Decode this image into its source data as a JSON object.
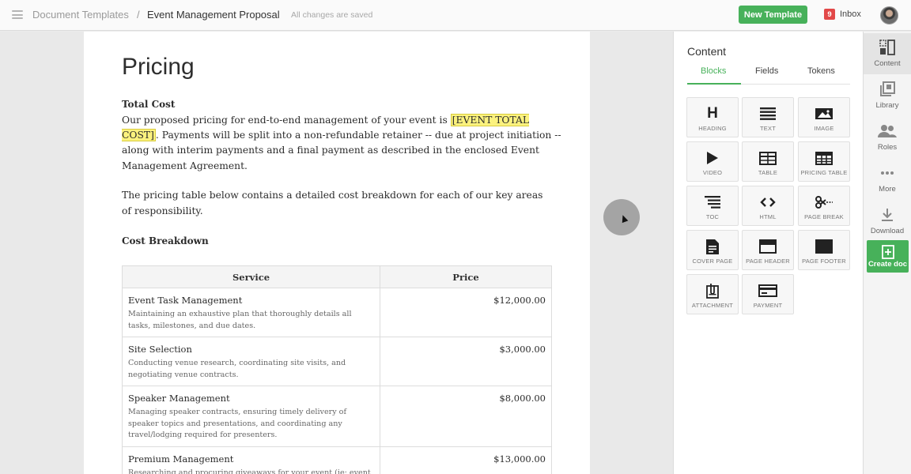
{
  "topbar": {
    "breadcrumb_root": "Document Templates",
    "separator": "/",
    "document_name": "Event Management Proposal",
    "save_status": "All changes are saved",
    "new_template_label": "New Template",
    "inbox_count": "9",
    "inbox_label": "Inbox"
  },
  "document": {
    "heading": "Pricing",
    "total_cost_heading": "Total Cost",
    "para1_before": "Our proposed pricing for end-to-end management of your event is ",
    "para1_token": "[EVENT TOTAL COST]",
    "para1_after": ". Payments will be split into a non-refundable retainer -- due at project initiation -- along with interim payments and a final payment as described in the enclosed Event Management Agreement.",
    "para2": "The pricing table below contains a detailed cost breakdown for each of our key areas of responsibility.",
    "cost_breakdown_heading": "Cost Breakdown",
    "table": {
      "headers": [
        "Service",
        "Price"
      ],
      "rows": [
        {
          "service": "Event Task Management",
          "description": "Maintaining an exhaustive plan that thoroughly details all tasks, milestones, and due dates.",
          "price": "$12,000.00"
        },
        {
          "service": "Site Selection",
          "description": "Conducting venue research, coordinating site visits, and negotiating venue contracts.",
          "price": "$3,000.00"
        },
        {
          "service": "Speaker Management",
          "description": "Managing speaker contracts, ensuring timely delivery of speaker topics and presentations, and coordinating any travel/lodging required for presenters.",
          "price": "$8,000.00"
        },
        {
          "service": "Premium Management",
          "description": "Researching and procuring giveaways for your event (ie: event swag,",
          "price": "$13,000.00"
        }
      ]
    }
  },
  "panel": {
    "title": "Content",
    "tabs": [
      "Blocks",
      "Fields",
      "Tokens"
    ],
    "active_tab": "Blocks",
    "blocks": [
      {
        "label": "HEADING",
        "icon": "heading-icon"
      },
      {
        "label": "TEXT",
        "icon": "text-icon"
      },
      {
        "label": "IMAGE",
        "icon": "image-icon"
      },
      {
        "label": "VIDEO",
        "icon": "video-icon"
      },
      {
        "label": "TABLE",
        "icon": "table-icon"
      },
      {
        "label": "PRICING TABLE",
        "icon": "pricing-table-icon"
      },
      {
        "label": "TOC",
        "icon": "toc-icon"
      },
      {
        "label": "HTML",
        "icon": "html-icon"
      },
      {
        "label": "PAGE BREAK",
        "icon": "page-break-icon"
      },
      {
        "label": "COVER PAGE",
        "icon": "cover-page-icon"
      },
      {
        "label": "PAGE HEADER",
        "icon": "page-header-icon"
      },
      {
        "label": "PAGE FOOTER",
        "icon": "page-footer-icon"
      },
      {
        "label": "ATTACHMENT",
        "icon": "attachment-icon"
      },
      {
        "label": "PAYMENT",
        "icon": "payment-icon"
      }
    ]
  },
  "rail": {
    "items": [
      {
        "label": "Content",
        "icon": "content-icon"
      },
      {
        "label": "Library",
        "icon": "library-icon"
      },
      {
        "label": "Roles",
        "icon": "roles-icon"
      },
      {
        "label": "More",
        "icon": "more-icon"
      },
      {
        "label": "Download",
        "icon": "download-icon"
      }
    ],
    "create_label": "Create doc"
  },
  "colors": {
    "accent": "#47b15a",
    "badge": "#e24848",
    "highlight": "#fbf27e"
  }
}
